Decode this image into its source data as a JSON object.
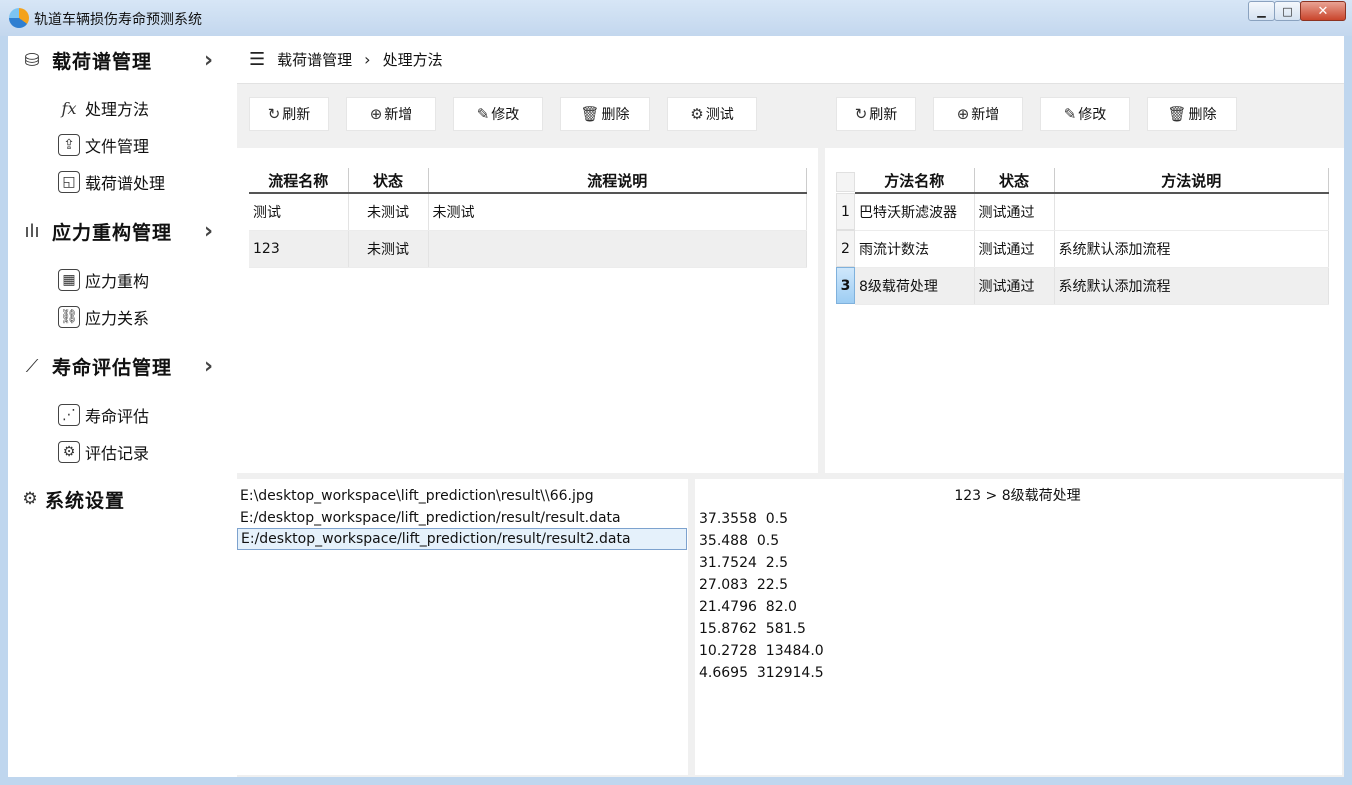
{
  "window": {
    "title": "轨道车辆损伤寿命预测系统",
    "minimize": "▁",
    "maximize": "□",
    "close": "✕"
  },
  "sidebar": {
    "categories": [
      {
        "label": "载荷谱管理",
        "icon": "folder-gear-icon",
        "glyph": "⛁",
        "items": [
          {
            "label": "处理方法",
            "icon": "function-icon",
            "glyph": "fx"
          },
          {
            "label": "文件管理",
            "icon": "file-upload-icon",
            "glyph": "⇪"
          },
          {
            "label": "载荷谱处理",
            "icon": "chart-window-icon",
            "glyph": "◱"
          }
        ]
      },
      {
        "label": "应力重构管理",
        "icon": "waveform-icon",
        "glyph": "ılı",
        "items": [
          {
            "label": "应力重构",
            "icon": "grid-icon",
            "glyph": "▦"
          },
          {
            "label": "应力关系",
            "icon": "link-icon",
            "glyph": "⛓"
          }
        ]
      },
      {
        "label": "寿命评估管理",
        "icon": "line-chart-icon",
        "glyph": "⟋",
        "items": [
          {
            "label": "寿命评估",
            "icon": "trend-icon",
            "glyph": "⋰"
          },
          {
            "label": "评估记录",
            "icon": "gear-record-icon",
            "glyph": "⚙"
          }
        ]
      },
      {
        "label": "系统设置",
        "icon": "gear-icon",
        "glyph": "⚙",
        "items": []
      }
    ],
    "arrow": "›"
  },
  "breadcrumb": {
    "menu_glyph": "☰",
    "root": "载荷谱管理",
    "sep": "›",
    "current": "处理方法"
  },
  "toolbar_left": {
    "refresh": "刷新",
    "add": "新增",
    "edit": "修改",
    "delete": "删除",
    "test": "测试"
  },
  "toolbar_right": {
    "refresh": "刷新",
    "add": "新增",
    "edit": "修改",
    "delete": "删除"
  },
  "icons": {
    "refresh": "↻",
    "add": "⊕",
    "edit": "✎",
    "delete": "🗑",
    "test": "⚙"
  },
  "flow_table": {
    "headers": [
      "流程名称",
      "状态",
      "流程说明"
    ],
    "rows": [
      {
        "name": "测试",
        "status": "未测试",
        "desc": "未测试"
      },
      {
        "name": "123",
        "status": "未测试",
        "desc": ""
      }
    ]
  },
  "method_table": {
    "headers": [
      "方法名称",
      "状态",
      "方法说明"
    ],
    "rows": [
      {
        "num": "1",
        "name": "巴特沃斯滤波器",
        "status": "测试通过",
        "desc": ""
      },
      {
        "num": "2",
        "name": "雨流计数法",
        "status": "测试通过",
        "desc": "系统默认添加流程"
      },
      {
        "num": "3",
        "name": "8级载荷处理",
        "status": "测试通过",
        "desc": "系统默认添加流程"
      }
    ]
  },
  "files": [
    "E:\\desktop_workspace\\lift_prediction\\result\\\\66.jpg",
    "E:/desktop_workspace/lift_prediction/result/result.data",
    "E:/desktop_workspace/lift_prediction/result/result2.data"
  ],
  "output": {
    "title": "123 > 8级载荷处理",
    "lines": [
      "37.3558  0.5",
      "35.488  0.5",
      "31.7524  2.5",
      "27.083  22.5",
      "21.4796  82.0",
      "15.8762  581.5",
      "10.2728  13484.0",
      "4.6695  312914.5"
    ]
  }
}
